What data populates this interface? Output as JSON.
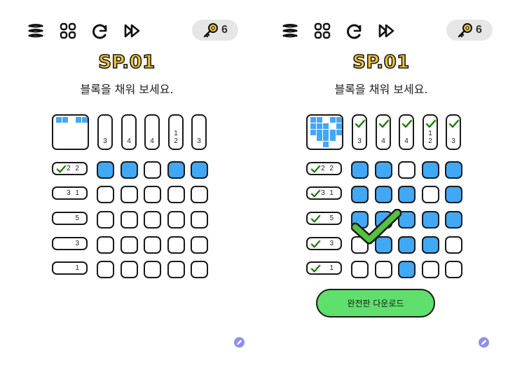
{
  "keys_count": "6",
  "level_title": "SP.01",
  "instruction": "블록을 채워 보세요.",
  "download_label": "완전판 다운로드",
  "colors": {
    "fill": "#41a8f5",
    "check": "#56c13f",
    "title": "#f4c431",
    "button": "#5fe06c"
  },
  "toolbar_icons": [
    "menu-icon",
    "grid-icon",
    "restart-icon",
    "skip-icon",
    "key-icon"
  ],
  "column_clues": [
    [
      "3"
    ],
    [
      "4"
    ],
    [
      "4"
    ],
    [
      "1",
      "2"
    ],
    [
      "3"
    ]
  ],
  "row_clues": [
    "2 2",
    "3 1",
    "5",
    "3",
    "1"
  ],
  "left_panel": {
    "state": "in-progress",
    "column_solved": [
      false,
      false,
      false,
      false,
      false
    ],
    "row_solved": [
      true,
      false,
      false,
      false,
      false
    ],
    "grid": [
      [
        1,
        1,
        0,
        1,
        1
      ],
      [
        0,
        0,
        0,
        0,
        0
      ],
      [
        0,
        0,
        0,
        0,
        0
      ],
      [
        0,
        0,
        0,
        0,
        0
      ],
      [
        0,
        0,
        0,
        0,
        0
      ]
    ]
  },
  "right_panel": {
    "state": "completed",
    "column_solved": [
      true,
      true,
      true,
      true,
      true
    ],
    "row_solved": [
      true,
      true,
      true,
      true,
      true
    ],
    "grid": [
      [
        1,
        1,
        0,
        1,
        1
      ],
      [
        1,
        1,
        1,
        0,
        1
      ],
      [
        1,
        1,
        1,
        1,
        1
      ],
      [
        0,
        1,
        1,
        1,
        0
      ],
      [
        0,
        0,
        1,
        0,
        0
      ]
    ]
  }
}
